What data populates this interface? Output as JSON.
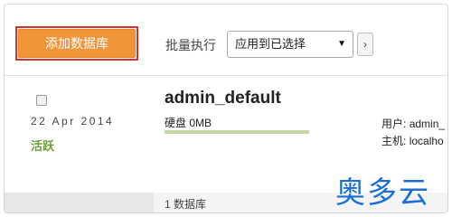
{
  "toolbar": {
    "add_button_label": "添加数据库",
    "bulk_action_label": "批量执行",
    "bulk_select_value": "应用到已选择",
    "go_button_label": "›"
  },
  "database": {
    "name": "admin_default",
    "date": "22 Apr 2014",
    "status": "活跃",
    "disk_label": "硬盘",
    "disk_value": "0MB",
    "user_label": "用户:",
    "user_value": "admin_",
    "host_label": "主机:",
    "host_value": "localho"
  },
  "footer": {
    "count_label": "1 数据库"
  },
  "watermark": {
    "text": "奥多云"
  },
  "colors": {
    "add_button": "#f29538",
    "highlight_border": "#d9302c",
    "status_green": "#6e9d3a",
    "disk_bar": "#c6d8a8",
    "watermark_blue": "#1a6fd6"
  }
}
